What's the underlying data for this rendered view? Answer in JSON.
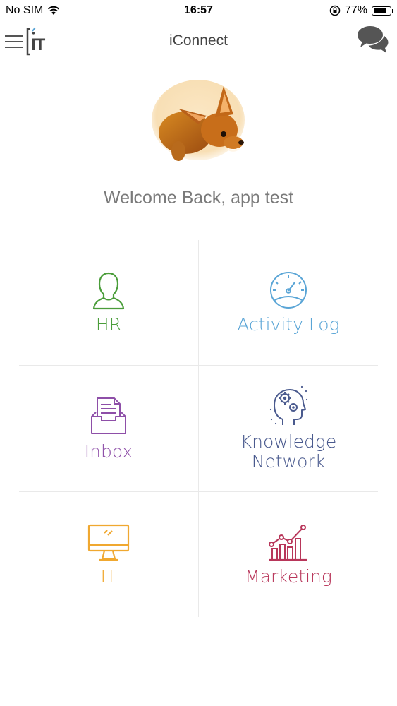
{
  "status_bar": {
    "carrier": "No SIM",
    "time": "16:57",
    "battery_percent": "77%",
    "battery_level": 0.77
  },
  "nav": {
    "title": "iConnect",
    "menu_icon": "hamburger-menu-icon",
    "logo": "IT",
    "chat_icon": "chat-bubbles-icon"
  },
  "profile": {
    "welcome_text": "Welcome Back, app test"
  },
  "tiles": [
    {
      "label": "HR",
      "icon": "person-icon",
      "color": "#4a9d3a"
    },
    {
      "label": "Activity Log",
      "icon": "gauge-icon",
      "color": "#5aa5d6"
    },
    {
      "label": "Inbox",
      "icon": "inbox-tray-icon",
      "color": "#8e4fa8"
    },
    {
      "label": "Knowledge\nNetwork",
      "icon": "brain-gears-icon",
      "color": "#4a5a8e"
    },
    {
      "label": "IT",
      "icon": "monitor-icon",
      "color": "#f0a830"
    },
    {
      "label": "Marketing",
      "icon": "bar-chart-icon",
      "color": "#b8365a"
    }
  ]
}
